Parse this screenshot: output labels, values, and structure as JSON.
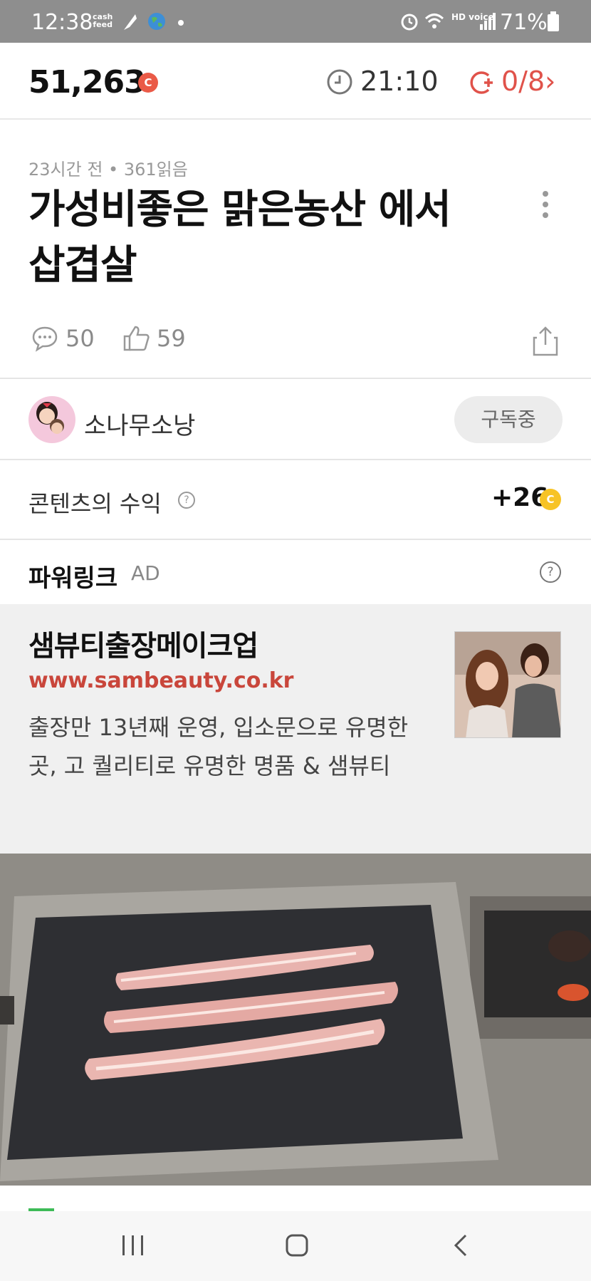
{
  "status_bar": {
    "time": "12:38",
    "cashfeed_line1": "cash",
    "cashfeed_line2": "feed",
    "battery": "71%",
    "network": "HD voice"
  },
  "header": {
    "balance": "51,263",
    "coin_symbol": "C",
    "timer": "21:10",
    "missions": "0/8",
    "mission_color": "#e0524a"
  },
  "article": {
    "meta": "23시간 전 • 361읽음",
    "title": "가성비좋은 맑은농산 에서 삽겹살",
    "comments": "50",
    "likes": "59"
  },
  "author": {
    "name": "소나무소낭",
    "subscribe_label": "구독중"
  },
  "earnings": {
    "label": "콘텐츠의 수익",
    "help": "?",
    "value": "+26",
    "coin_symbol": "C"
  },
  "powerlink": {
    "title": "파워링크",
    "ad_tag": "AD",
    "help": "?",
    "ad": {
      "name": "샘뷰티출장메이크업",
      "url": "www.sambeauty.co.kr",
      "description": "출장만 13년째 운영, 입소문으로 유명한 곳, 고 퀄리티로 유명한 명품 & 샘뷰티"
    }
  },
  "nav": {
    "icons": [
      "recent-apps-icon",
      "home-icon",
      "back-icon"
    ]
  },
  "colors": {
    "accent_red": "#e0524a",
    "coin_yellow": "#f7c325",
    "status_bar_bg": "#8e8e8e"
  }
}
